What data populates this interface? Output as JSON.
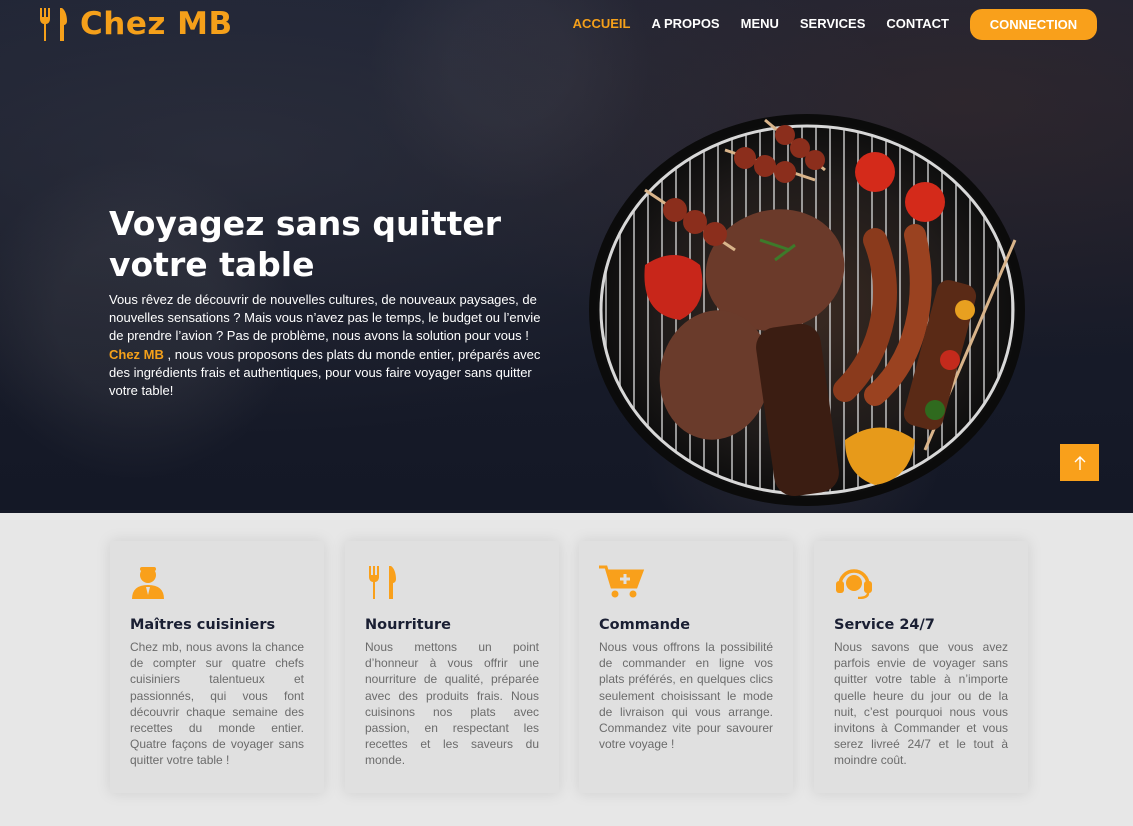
{
  "brand": {
    "name": "Chez MB",
    "icon": "fork-knife-icon"
  },
  "nav": {
    "items": [
      "ACCUEIL",
      "A PROPOS",
      "MENU",
      "SERVICES",
      "CONTACT"
    ],
    "active": "ACCUEIL",
    "connect": "CONNECTION"
  },
  "hero": {
    "title": "Voyagez sans quitter votre table",
    "desc_part1": "Vous rêvez de découvrir de nouvelles cultures, de nouveaux paysages, de nouvelles sensations ? Mais vous n’avez pas le temps, le budget ou l’envie de prendre l’avion ? Pas de problème, nous avons la solution pour vous !",
    "desc_brand": "Chez MB",
    "desc_part2": " , nous vous proposons des plats du monde entier, préparés avec des ingrédients frais et authentiques, pour vous faire voyager sans quitter votre table!"
  },
  "scroll_top": {
    "icon": "arrow-up-icon"
  },
  "features": [
    {
      "icon": "chef-icon",
      "title": "Maîtres cuisiniers",
      "text": "Chez mb, nous avons la chance de compter sur quatre chefs cuisiniers talentueux et passionnés, qui vous font découvrir chaque semaine des recettes du monde entier. Quatre façons de voyager sans quitter votre table !"
    },
    {
      "icon": "fork-knife-icon",
      "title": "Nourriture",
      "text": "Nous mettons un point d’honneur à vous offrir une nourriture de qualité, préparée avec des produits frais. Nous cuisinons nos plats avec passion, en respectant les recettes et les saveurs du monde."
    },
    {
      "icon": "cart-plus-icon",
      "title": "Commande",
      "text": "Nous vous offrons la possibilité de commander en ligne vos plats préférés, en quelques clics seulement choisissant le mode de livraison qui vous arrange. Commandez vite pour savourer votre voyage !"
    },
    {
      "icon": "headset-icon",
      "title": "Service 24/7",
      "text": "Nous savons que vous avez parfois envie de voyager sans quitter votre table à n’importe quelle heure du jour ou de la nuit, c’est pourquoi nous vous invitons à Commander et vous serez livreé 24/7 et le tout à moindre coût."
    }
  ],
  "colors": {
    "accent": "#f9a01b",
    "hero_bg": "#1a1f2e",
    "title_dark": "#1a1f33"
  }
}
